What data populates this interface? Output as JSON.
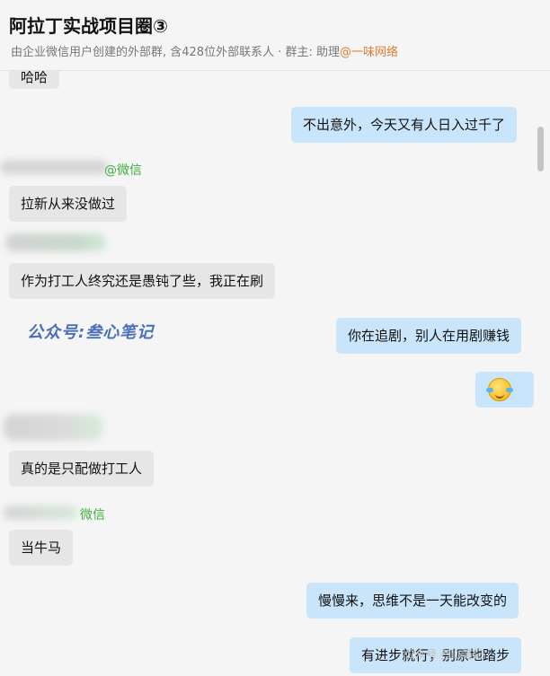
{
  "header": {
    "title": "阿拉丁实战项目圈③",
    "subtitle_prefix": "由企业微信用户创建的外部群, 含428位外部联系人 · 群主: 助理",
    "subtitle_owner": "@一味网络"
  },
  "messages": [
    {
      "side": "left",
      "text": "哈哈"
    },
    {
      "side": "right",
      "text": "不出意外，今天又有人日入过千了"
    },
    {
      "side": "left",
      "platform": "@微信",
      "text": "拉新从来没做过"
    },
    {
      "side": "left",
      "text": "作为打工人终究还是愚钝了些，我正在刷"
    },
    {
      "side": "right",
      "text": "你在追剧，别人在用剧赚钱"
    },
    {
      "side": "right",
      "emoji": "laugh-cry-emoji"
    },
    {
      "side": "left",
      "text": "真的是只配做打工人"
    },
    {
      "side": "left",
      "platform": "微信",
      "text": "当牛马"
    },
    {
      "side": "right",
      "text": "慢慢来，思维不是一天能改变的"
    },
    {
      "side": "right",
      "text": "有进步就行，别原地踏步"
    }
  ],
  "watermark": "公众号:叁心笔记",
  "corner_watermark": "公众号 叁心笔记",
  "colors": {
    "right_bubble": "#c9e5fb",
    "left_bubble": "#e6e6e6",
    "wechat_green": "#3fae3c",
    "owner_link": "#e07b2e"
  }
}
